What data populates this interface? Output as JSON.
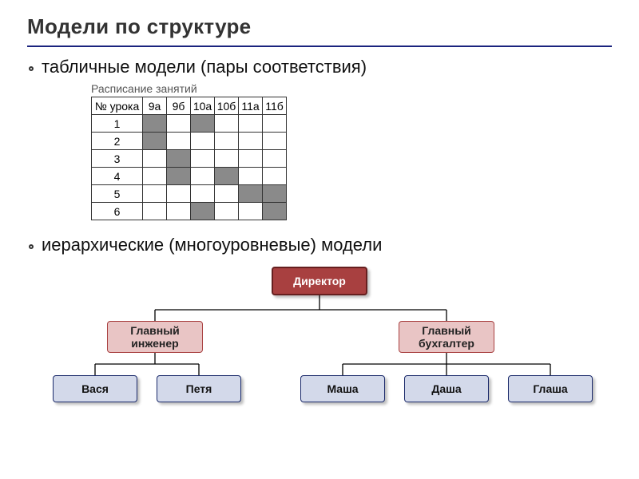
{
  "title": "Модели по структуре",
  "bullets": {
    "b1": "табличные модели (пары соответствия)",
    "b2": "иерархические (многоуровневые) модели"
  },
  "table": {
    "caption": "Расписание занятий",
    "lesson_header": "№ урока",
    "columns": [
      "9а",
      "9б",
      "10а",
      "10б",
      "11а",
      "11б"
    ],
    "rows": [
      "1",
      "2",
      "3",
      "4",
      "5",
      "6"
    ],
    "filled": [
      [
        1,
        0,
        1,
        0,
        0,
        0
      ],
      [
        1,
        0,
        0,
        0,
        0,
        0
      ],
      [
        0,
        1,
        0,
        0,
        0,
        0
      ],
      [
        0,
        1,
        0,
        1,
        0,
        0
      ],
      [
        0,
        0,
        0,
        0,
        1,
        1
      ],
      [
        0,
        0,
        1,
        0,
        0,
        1
      ]
    ]
  },
  "hierarchy": {
    "root": "Директор",
    "managers": [
      "Главный\nинженер",
      "Главный\nбухгалтер"
    ],
    "employees": [
      "Вася",
      "Петя",
      "Маша",
      "Даша",
      "Глаша"
    ]
  }
}
